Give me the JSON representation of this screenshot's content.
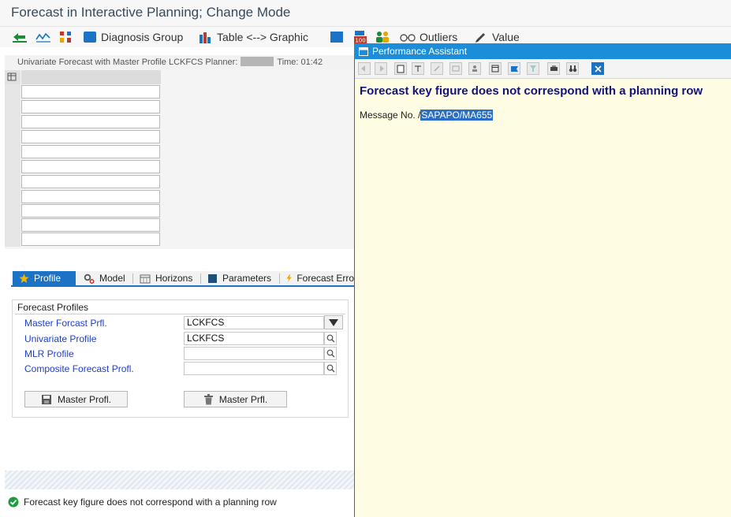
{
  "window": {
    "title": "Forecast in Interactive Planning; Change Mode"
  },
  "toolbar": {
    "items": [
      {
        "icon": "back-arrow-icon"
      },
      {
        "icon": "line-chart-icon"
      },
      {
        "icon": "bar-chart-icon"
      },
      {
        "icon": "blue-square-icon",
        "label": "Diagnosis Group"
      },
      {
        "icon": "table-graphic-icon",
        "label": "Table <--> Graphic"
      },
      {
        "icon": "blue-square-icon"
      },
      {
        "icon": "calendar-100-icon"
      },
      {
        "icon": "people-icon"
      },
      {
        "icon": "glasses-icon",
        "label": "Outliers"
      },
      {
        "icon": "pencil-icon",
        "label": "Value"
      }
    ]
  },
  "info": {
    "text": "Univariate Forecast with Master Profile LCKFCS Planner:",
    "time_label": "Time: 01:42"
  },
  "tabs": [
    {
      "label": "Profile",
      "icon": "star-icon",
      "active": true
    },
    {
      "label": "Model",
      "icon": "gears-icon",
      "active": false
    },
    {
      "label": "Horizons",
      "icon": "calendar-icon",
      "active": false
    },
    {
      "label": "Parameters",
      "icon": "parameters-icon",
      "active": false
    },
    {
      "label": "Forecast Erro",
      "icon": "lightning-icon",
      "active": false
    }
  ],
  "profiles": {
    "title": "Forecast Profiles",
    "fields": [
      {
        "label": "Master Forcast Prfl.",
        "value": "LCKFCS"
      },
      {
        "label": "Univariate Profile",
        "value": "LCKFCS"
      },
      {
        "label": "MLR Profile",
        "value": ""
      },
      {
        "label": "Composite Forecast Profl.",
        "value": ""
      }
    ],
    "buttons": [
      {
        "label": "Master Profl.",
        "icon": "save-icon"
      },
      {
        "label": "Master Prfl.",
        "icon": "trash-icon"
      }
    ]
  },
  "status": {
    "message": "Forecast key figure does not correspond with a planning row",
    "icon": "success-check-icon"
  },
  "assistant": {
    "title": "Performance Assistant",
    "heading": "Forecast key figure does not correspond with a planning row",
    "message_label": "Message No. /",
    "message_code": "SAPAPO/MA655"
  },
  "colors": {
    "accent": "#1c73c6",
    "assistant_bg": "#fefce2",
    "heading": "#13137a",
    "link": "#1e3fc8"
  }
}
